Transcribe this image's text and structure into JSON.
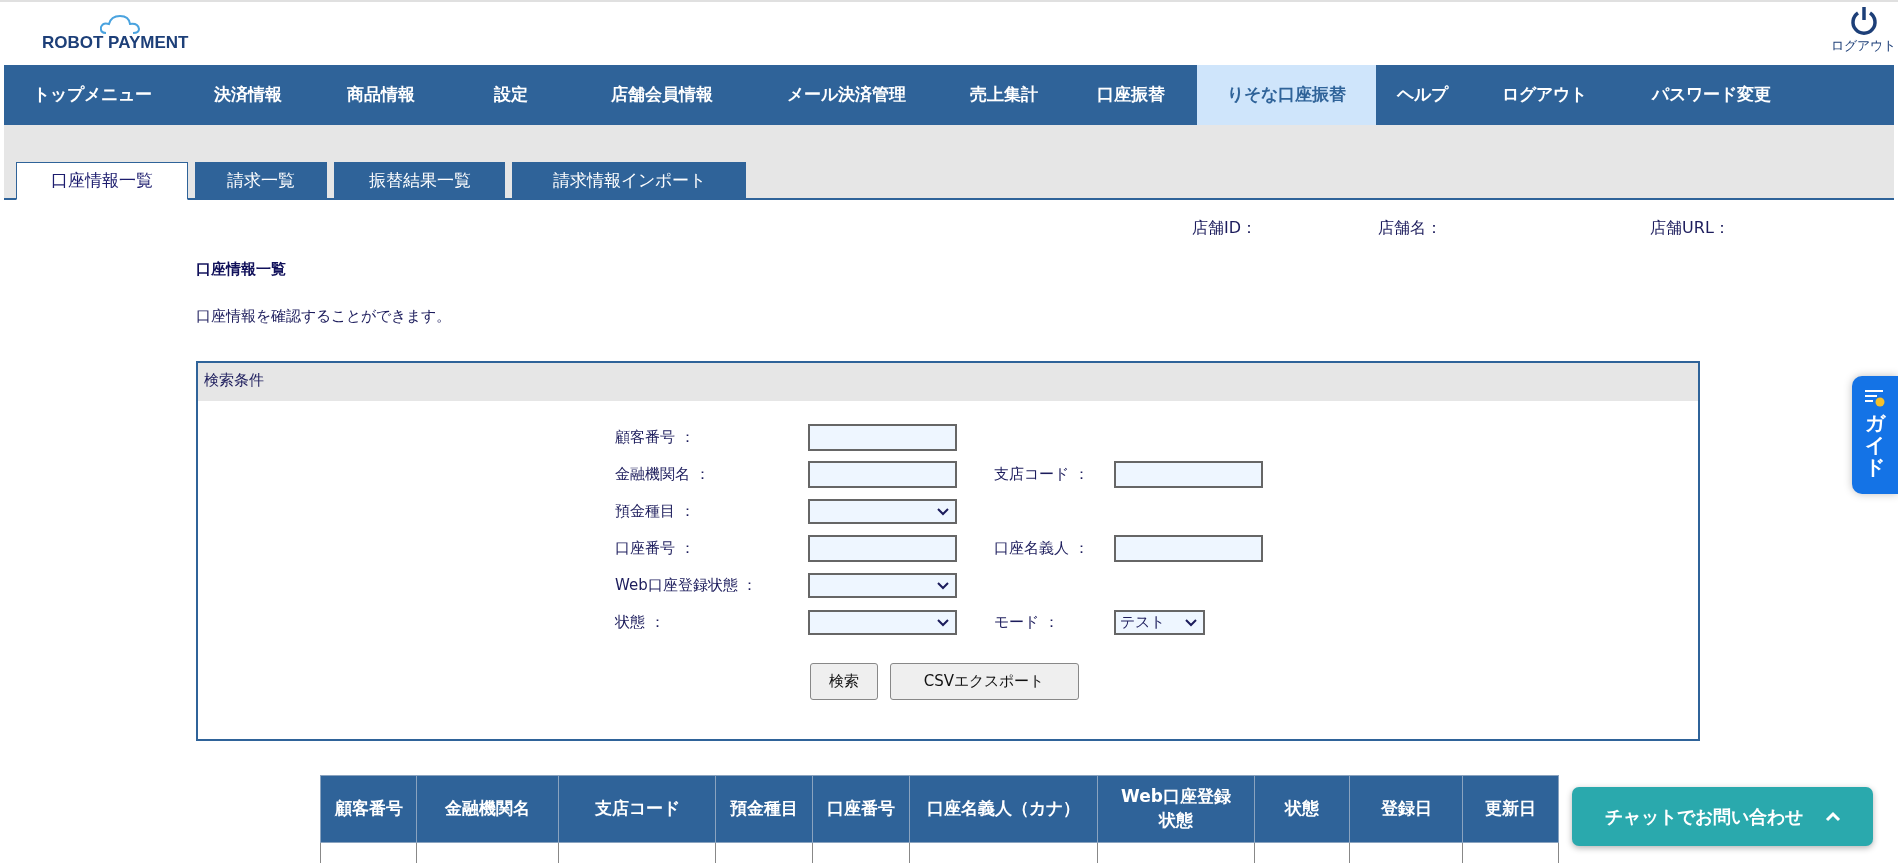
{
  "header": {
    "logo": "ROBOT PAYMENT",
    "logout_label": "ログアウト"
  },
  "nav": [
    {
      "label": "トップメニュー",
      "selected": false
    },
    {
      "label": "決済情報",
      "selected": false
    },
    {
      "label": "商品情報",
      "selected": false
    },
    {
      "label": "設定",
      "selected": false
    },
    {
      "label": "店舗会員情報",
      "selected": false
    },
    {
      "label": "メール決済管理",
      "selected": false
    },
    {
      "label": "売上集計",
      "selected": false
    },
    {
      "label": "口座振替",
      "selected": false
    },
    {
      "label": "りそな口座振替",
      "selected": true
    },
    {
      "label": "ヘルプ",
      "selected": false
    },
    {
      "label": "ログアウト",
      "selected": false
    },
    {
      "label": "パスワード変更",
      "selected": false
    }
  ],
  "tabs": [
    {
      "label": "口座情報一覧",
      "selected": true
    },
    {
      "label": "請求一覧",
      "selected": false
    },
    {
      "label": "振替結果一覧",
      "selected": false
    },
    {
      "label": "請求情報インポート",
      "selected": false
    }
  ],
  "shop_info": [
    "店舗ID：",
    "店舗名：",
    "店舗URL："
  ],
  "page_title": "口座情報一覧",
  "description": "口座情報を確認することができます。",
  "search": {
    "title": "検索条件",
    "rows": [
      [
        {
          "label": "顧客番号 ：",
          "kind": "text"
        }
      ],
      [
        {
          "label": "金融機関名 ：",
          "kind": "text"
        },
        {
          "label": "支店コード ：",
          "kind": "text"
        }
      ],
      [
        {
          "label": "預金種目 ：",
          "kind": "select"
        }
      ],
      [
        {
          "label": "口座番号 ：",
          "kind": "text"
        },
        {
          "label": "口座名義人 ：",
          "kind": "text"
        }
      ],
      [
        {
          "label": "Web口座登録状態 ：",
          "kind": "select"
        }
      ],
      [
        {
          "label": "状態 ：",
          "kind": "select"
        },
        {
          "label": "モード ：",
          "kind": "select",
          "value": "テスト"
        }
      ]
    ],
    "buttons": [
      "検索",
      "CSVエクスポート"
    ]
  },
  "table": {
    "columns": [
      "顧客番号",
      "金融機関名",
      "支店コード",
      "預金種目",
      "口座番号",
      "口座名義人（カナ）",
      "Web口座登録状態",
      "状態",
      "登録日",
      "更新日"
    ]
  },
  "guide_tab": "ガイド",
  "chat_button": "チャットでお問い合わせ"
}
